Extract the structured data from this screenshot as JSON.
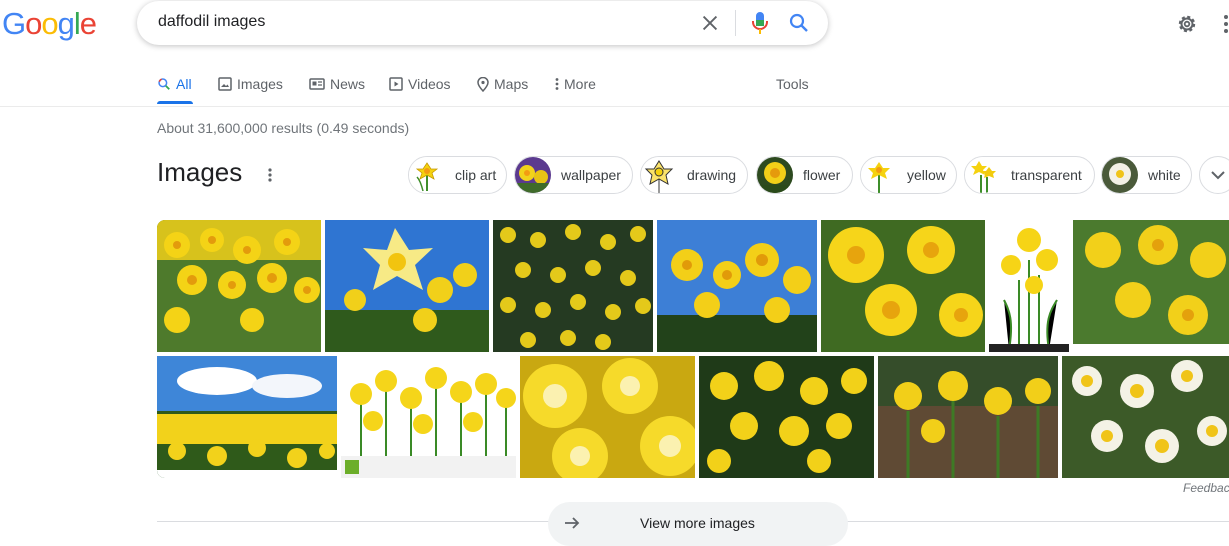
{
  "logo": {
    "letters": [
      {
        "ch": "G",
        "color": "#4285F4"
      },
      {
        "ch": "o",
        "color": "#EA4335"
      },
      {
        "ch": "o",
        "color": "#FBBC05"
      },
      {
        "ch": "g",
        "color": "#4285F4"
      },
      {
        "ch": "l",
        "color": "#34A853"
      },
      {
        "ch": "e",
        "color": "#EA4335"
      }
    ]
  },
  "search": {
    "query": "daffodil images"
  },
  "tabs": [
    {
      "label": "All",
      "icon": "search-icon",
      "active": true
    },
    {
      "label": "Images",
      "icon": "image-icon",
      "active": false
    },
    {
      "label": "News",
      "icon": "news-icon",
      "active": false
    },
    {
      "label": "Videos",
      "icon": "video-icon",
      "active": false
    },
    {
      "label": "Maps",
      "icon": "map-pin-icon",
      "active": false
    },
    {
      "label": "More",
      "icon": "more-dots-icon",
      "active": false
    }
  ],
  "tools_label": "Tools",
  "stats": "About 31,600,000 results (0.49 seconds)",
  "images_section": {
    "heading": "Images",
    "chips": [
      {
        "label": "clip art"
      },
      {
        "label": "wallpaper"
      },
      {
        "label": "drawing"
      },
      {
        "label": "flower"
      },
      {
        "label": "yellow"
      },
      {
        "label": "transparent"
      },
      {
        "label": "white"
      }
    ],
    "feedback": "Feedback",
    "view_more": "View more images"
  },
  "colors": {
    "accent": "#1a73e8",
    "daffodil_yellow": "#f2d21b",
    "leaf_green": "#3f6b2a",
    "sky_blue": "#3b7fd4"
  }
}
